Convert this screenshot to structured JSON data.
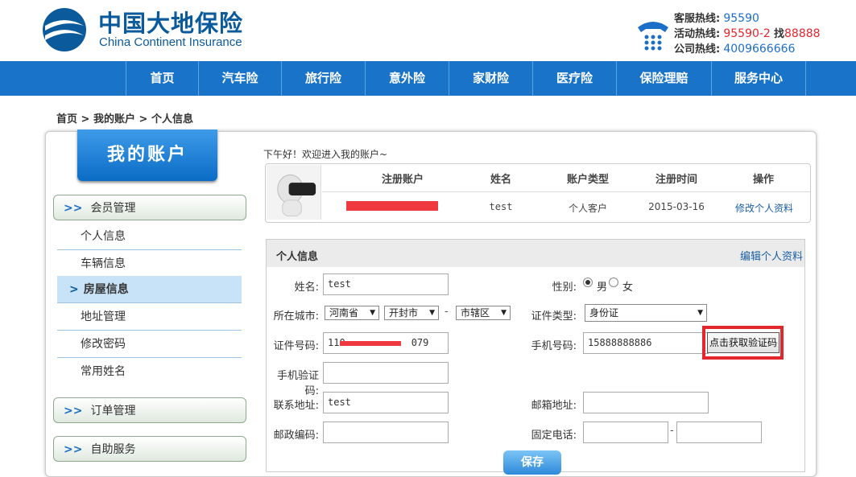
{
  "header": {
    "brand_cn": "中国大地保险",
    "brand_en": "China Continent Insurance",
    "hotlines": [
      {
        "label": "客服热线:",
        "value": "95590"
      },
      {
        "label": "活动热线:",
        "value": "95590-2",
        "suffix_label": "找",
        "suffix_value": "88888"
      },
      {
        "label": "公司热线:",
        "value": "4009666666"
      }
    ]
  },
  "nav": {
    "items": [
      "首页",
      "汽车险",
      "旅行险",
      "意外险",
      "家财险",
      "医疗险",
      "保险理赔",
      "服务中心"
    ]
  },
  "breadcrumb": {
    "home": "首页",
    "sep1": ">",
    "account": "我的账户",
    "sep2": ">",
    "current": "个人信息"
  },
  "sidebar": {
    "title": "我的账户",
    "chev": ">>",
    "active_arrow": ">",
    "group_member": "会员管理",
    "items": [
      "个人信息",
      "车辆信息",
      "房屋信息",
      "地址管理",
      "修改密码",
      "常用姓名"
    ],
    "group_orders": "订单管理",
    "group_self": "自助服务"
  },
  "greeting": "下午好！欢迎进入我的账户~",
  "user_table": {
    "headers": [
      "注册账户",
      "姓名",
      "账户类型",
      "注册时间",
      "操作"
    ],
    "row": {
      "name": "test",
      "type": "个人客户",
      "date": "2015-03-16",
      "action": "修改个人资料"
    }
  },
  "info": {
    "title": "个人信息",
    "edit_link": "编辑个人资料",
    "name_label": "姓名:",
    "name_value": "test",
    "gender_label": "性别:",
    "gender_male": "男",
    "gender_female": "女",
    "city_label": "所在城市:",
    "province": "河南省",
    "city": "开封市",
    "district": "市辖区",
    "dash": "-",
    "idtype_label": "证件类型:",
    "idtype_value": "身份证",
    "idno_label": "证件号码:",
    "idno_prefix": "110",
    "idno_suffix": "079",
    "mobile_label": "手机号码:",
    "mobile_value": "15888888886",
    "code_button": "点击获取验证码",
    "smscode_label": "手机验证码:",
    "address_label": "联系地址:",
    "address_value": "test",
    "email_label": "邮箱地址:",
    "zip_label": "邮政编码:",
    "phone_label": "固定电话:",
    "save_button": "保存"
  },
  "colors": {
    "brand": "#0a5a9c",
    "nav": "#1973c9",
    "highlight_red": "#e4262d"
  }
}
